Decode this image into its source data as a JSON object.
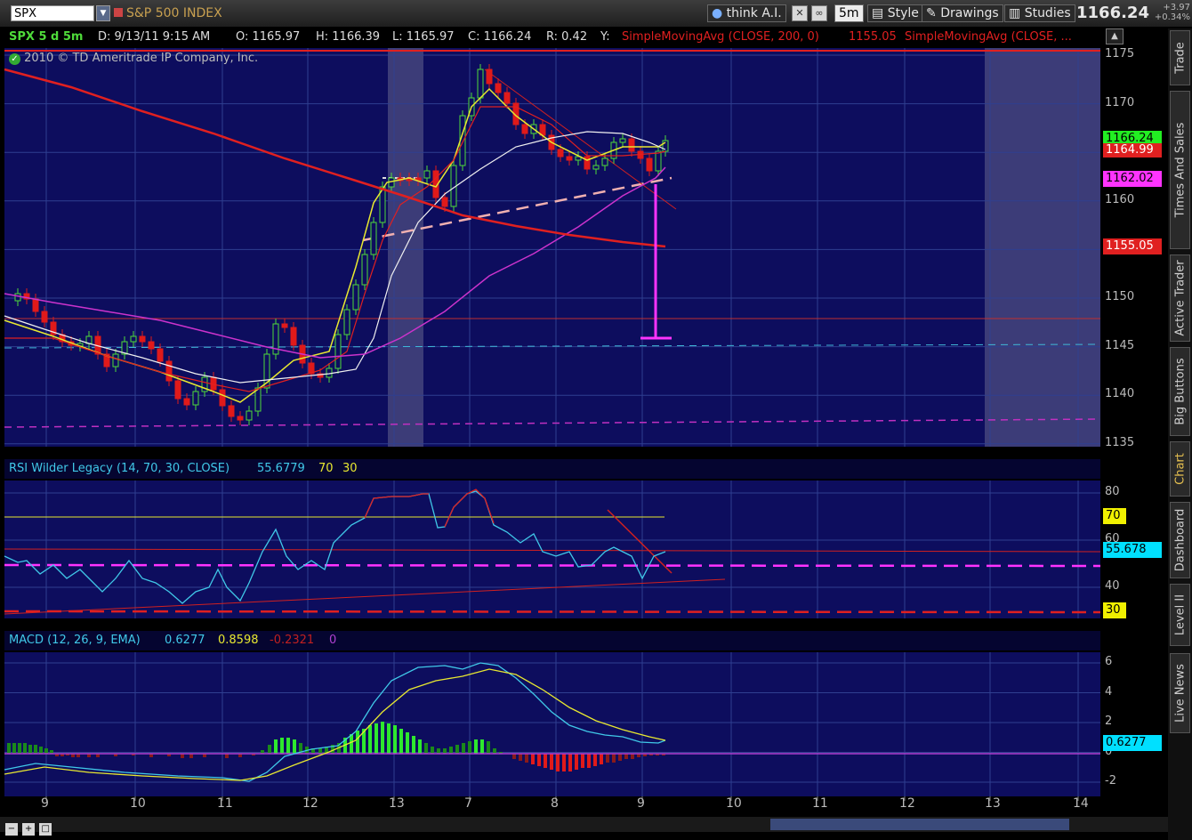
{
  "toolbar": {
    "symbol": "SPX",
    "instrument_name": "S&P 500 INDEX",
    "think_ai": "think A.I.",
    "timeframe": "5m",
    "style": "Style",
    "drawings": "Drawings",
    "studies": "Studies",
    "last_price": "1166.24",
    "change": "+3.97",
    "change_pct": "+0.34%"
  },
  "side_tabs": [
    "Trade",
    "Times And Sales",
    "Active Trader",
    "Big Buttons",
    "Chart",
    "Dashboard",
    "Level II",
    "Live News"
  ],
  "header": {
    "title": "SPX 5 d 5m",
    "date": "D: 9/13/11 9:15 AM",
    "open": "O: 1165.97",
    "high": "H: 1166.39",
    "low": "L: 1165.97",
    "close": "C: 1166.24",
    "range": "R: 0.42",
    "y": "Y:",
    "sma1": "SimpleMovingAvg (CLOSE, 200, 0)",
    "sma1_value": "1155.05",
    "sma2": "SimpleMovingAvg (CLOSE, ...",
    "copyright": "2010 © TD Ameritrade IP Company, Inc."
  },
  "price_axis": {
    "ticks": [
      "1175",
      "1170",
      "1165",
      "1160",
      "1155",
      "1150",
      "1145",
      "1140",
      "1135"
    ],
    "labels": {
      "last": "1166.24",
      "ema": "1164.99",
      "sma50": "1162.02",
      "sma200": "1155.05"
    }
  },
  "rsi": {
    "title": "RSI Wilder Legacy (14, 70, 30, CLOSE)",
    "value": "55.6779",
    "ob": "70",
    "os": "30",
    "ticks": [
      "80",
      "60",
      "40"
    ],
    "label_value": "55.678",
    "label_ob": "70",
    "label_os": "30"
  },
  "macd": {
    "title": "MACD (12, 26, 9, EMA)",
    "value": "0.6277",
    "avg": "0.8598",
    "diff": "-0.2321",
    "zero": "0",
    "ticks": [
      "6",
      "4",
      "2",
      "0",
      "-2"
    ],
    "label_value": "0.6277"
  },
  "time_axis": [
    "9",
    "10",
    "11",
    "12",
    "13",
    "7",
    "8",
    "9",
    "10",
    "11",
    "12",
    "13",
    "14"
  ],
  "colors": {
    "panel_bg": "#0d0d5e",
    "up": "#4fdc3a",
    "down": "#e01a1a",
    "sma200": "#e02020",
    "sma50": "#cc33cc",
    "white_ma": "#f0f0f0",
    "yellow_ma": "#e8e830",
    "rsi_line": "#40c8e8",
    "accent_magenta": "#ff33ff"
  }
}
